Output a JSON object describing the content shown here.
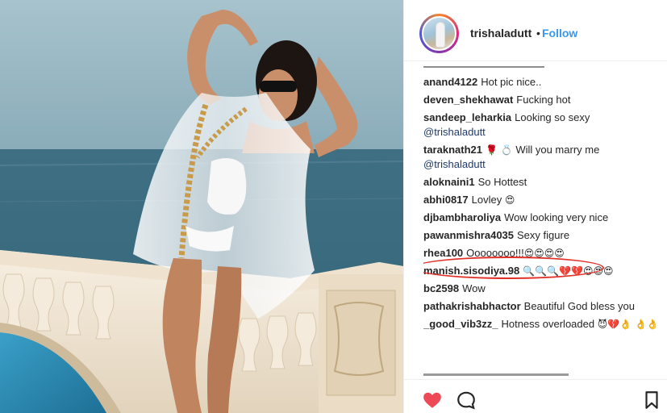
{
  "post": {
    "username": "trishaladutt",
    "separator": "•",
    "follow_label": "Follow"
  },
  "comments": [
    {
      "user": "anand4122",
      "text": "Hot pic nice..",
      "emoji": "",
      "mention": ""
    },
    {
      "user": "deven_shekhawat",
      "text": "Fucking hot",
      "emoji": "",
      "mention": ""
    },
    {
      "user": "sandeep_leharkia",
      "text": "Looking so sexy",
      "emoji": "",
      "mention": "@trishaladutt"
    },
    {
      "user": "taraknath21",
      "text": "Will you marry me",
      "emoji": "🌹 💍",
      "mention": "@trishaladutt"
    },
    {
      "user": "aloknaini1",
      "text": "So Hottest",
      "emoji": "",
      "mention": ""
    },
    {
      "user": "abhi0817",
      "text": "Lovley",
      "emoji": "😍",
      "mention": ""
    },
    {
      "user": "djbambharoliya",
      "text": "Wow looking very nice",
      "emoji": "",
      "mention": ""
    },
    {
      "user": "pawanmishra4035",
      "text": "Sexy figure",
      "emoji": "",
      "mention": ""
    },
    {
      "user": "rhea100",
      "text": "Oooooooo!!!",
      "emoji": "😍😍😍😍",
      "mention": ""
    },
    {
      "user": "manish.sisodiya.98",
      "text": "",
      "emoji": "🔍🔍🔍💔💔😍😍😍",
      "mention": ""
    },
    {
      "user": "bc2598",
      "text": "Wow",
      "emoji": "",
      "mention": ""
    },
    {
      "user": "pathakrishabhactor",
      "text": "Beautiful God bless you",
      "emoji": "",
      "mention": ""
    },
    {
      "user": "_good_vib3zz_",
      "text": "Hotness overloaded",
      "emoji": "😈💔👌 👌👌",
      "mention": ""
    }
  ],
  "icons": {
    "like": "heart-icon",
    "comment": "comment-icon",
    "save": "bookmark-icon"
  },
  "colors": {
    "like_red": "#ed4956",
    "follow_blue": "#3897f0",
    "highlight_red": "#e23028"
  }
}
